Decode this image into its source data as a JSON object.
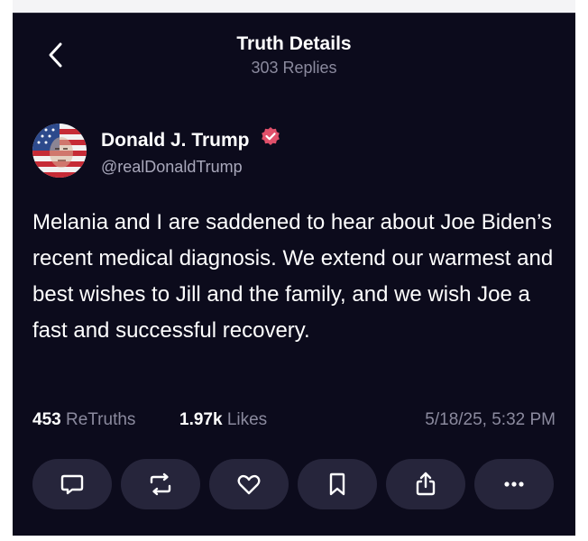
{
  "header": {
    "title": "Truth Details",
    "subtitle": "303 Replies"
  },
  "author": {
    "name": "Donald J. Trump",
    "handle": "@realDonaldTrump",
    "verified": true
  },
  "post": {
    "text": "Melania and I are saddened to hear about Joe Biden’s recent medical diagnosis. We extend our warmest and best wishes to Jill and the family, and we wish Joe a fast and successful recovery."
  },
  "stats": {
    "retruths_count": "453",
    "retruths_label": "ReTruths",
    "likes_count": "1.97k",
    "likes_label": "Likes",
    "timestamp": "5/18/25, 5:32 PM"
  },
  "actions": [
    {
      "icon": "reply-icon"
    },
    {
      "icon": "retruth-icon"
    },
    {
      "icon": "heart-icon"
    },
    {
      "icon": "bookmark-icon"
    },
    {
      "icon": "share-icon"
    },
    {
      "icon": "more-icon"
    }
  ],
  "colors": {
    "background": "#0c0b1c",
    "button": "#26253b",
    "muted_text": "#8b8a9e",
    "verified_badge": "#e0506a"
  }
}
